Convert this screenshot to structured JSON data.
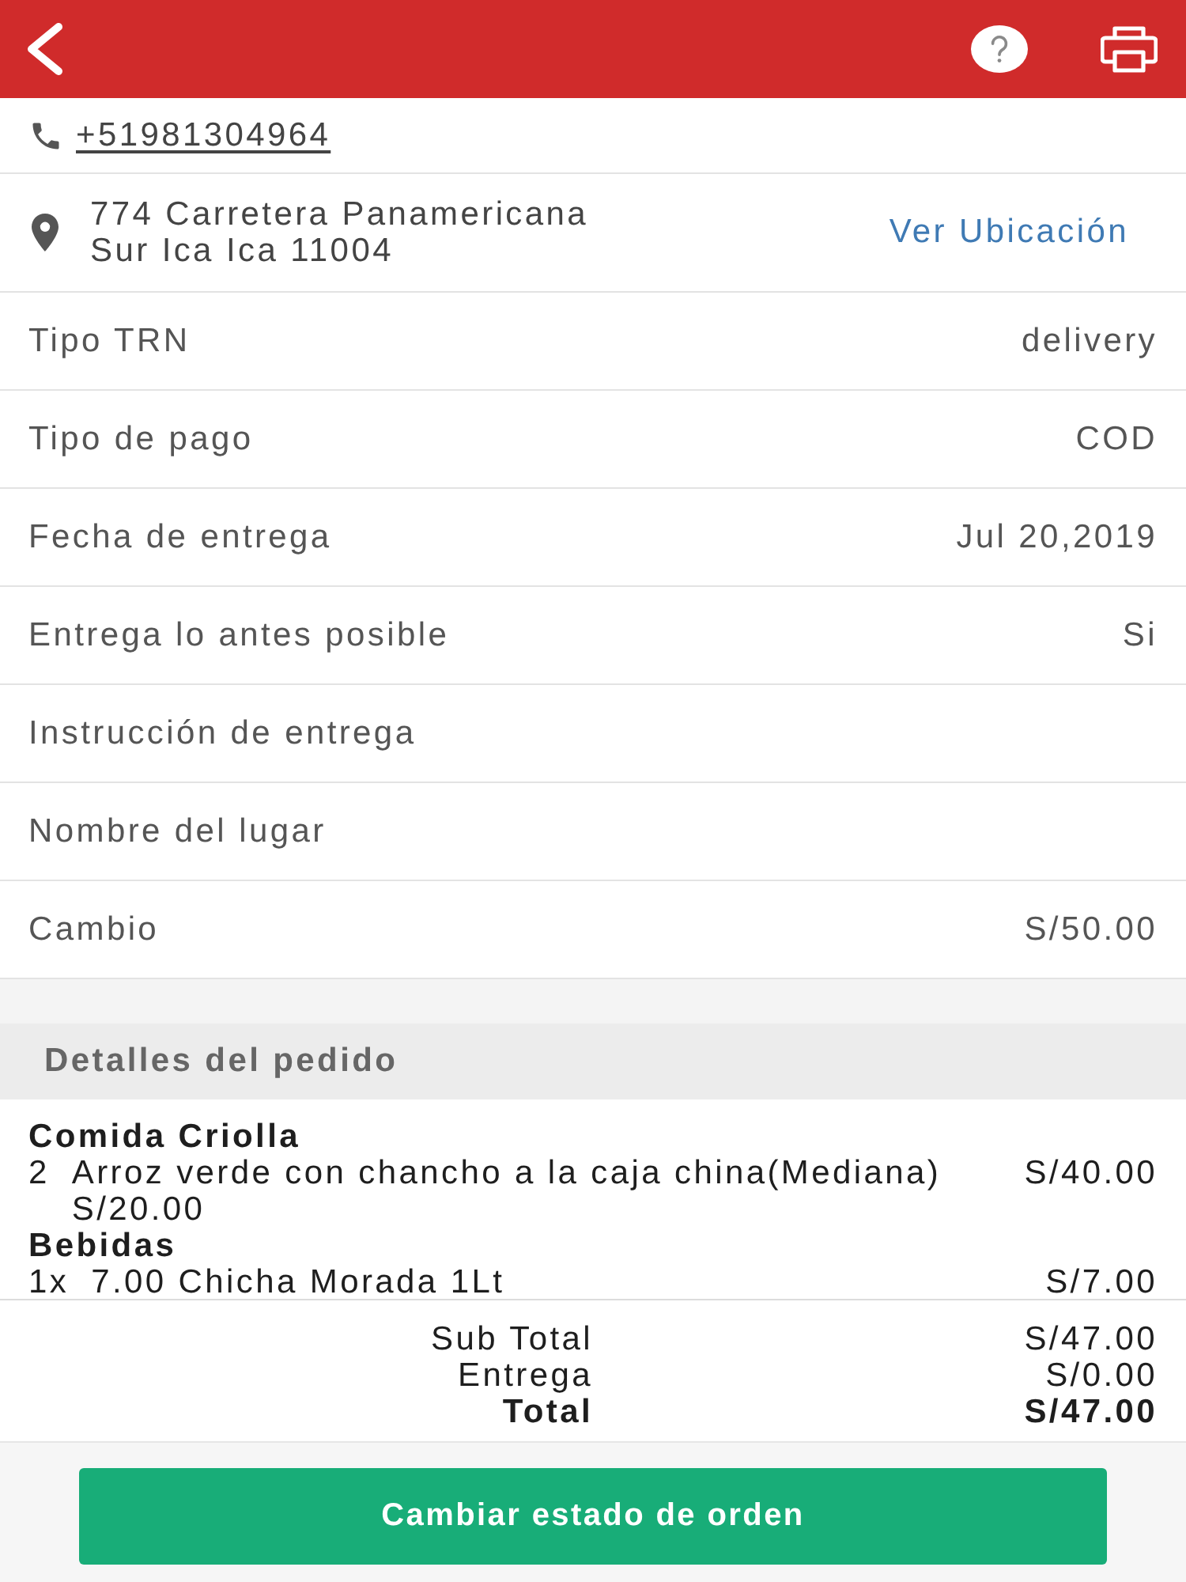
{
  "contact": {
    "phone": "+51981304964",
    "address": "774 Carretera Panamericana Sur Ica Ica 11004",
    "location_link": "Ver Ubicación"
  },
  "details": [
    {
      "label": "Tipo TRN",
      "value": "delivery"
    },
    {
      "label": "Tipo de pago",
      "value": "COD"
    },
    {
      "label": "Fecha de entrega",
      "value": "Jul 20,2019"
    },
    {
      "label": "Entrega lo antes posible",
      "value": "Si"
    },
    {
      "label": "Instrucción de entrega"
    },
    {
      "label": "Nombre del lugar"
    },
    {
      "label": "Cambio",
      "value": "S/50.00"
    }
  ],
  "order": {
    "title": "Detalles del pedido",
    "groups": [
      {
        "name": "Comida Criolla",
        "items": [
          {
            "qty": "2",
            "name": "Arroz verde con chancho a la caja china(Mediana)",
            "price": "S/40.00",
            "unit_price": "S/20.00"
          }
        ]
      },
      {
        "name": "Bebidas",
        "items": [
          {
            "qty": "1x",
            "name": "7.00 Chicha Morada 1Lt",
            "price": "S/7.00"
          }
        ]
      }
    ]
  },
  "totals": [
    {
      "kind": "line",
      "label": "Sub Total",
      "value": "S/47.00"
    },
    {
      "kind": "line",
      "label": "Entrega",
      "value": "S/0.00"
    },
    {
      "kind": "grand",
      "label": "Total",
      "value": "S/47.00"
    }
  ],
  "action_button": "Cambiar estado de orden"
}
